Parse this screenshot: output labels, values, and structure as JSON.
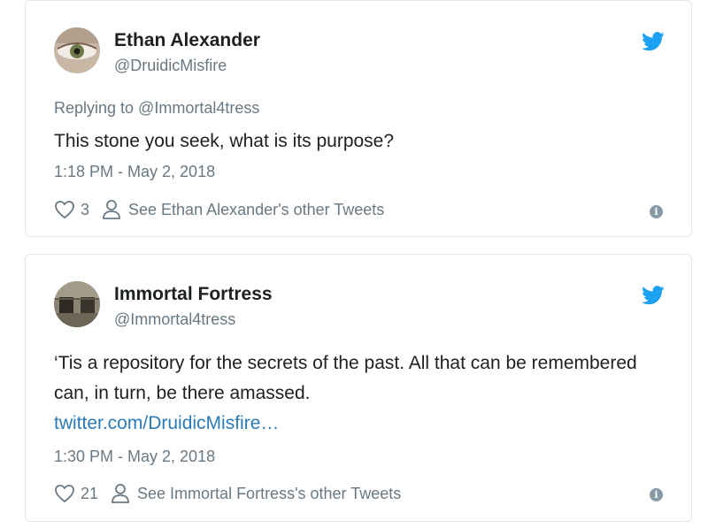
{
  "tweets": [
    {
      "author_name": "Ethan Alexander",
      "handle": "@DruidicMisfire",
      "reply_to": "Replying to @Immortal4tress",
      "text": "This stone you seek, what is its purpose?",
      "link": "",
      "timestamp": "1:18 PM - May 2, 2018",
      "likes": "3",
      "other_tweets_label": "See Ethan Alexander's other Tweets",
      "info_icon": "i"
    },
    {
      "author_name": "Immortal Fortress",
      "handle": "@Immortal4tress",
      "reply_to": "",
      "text": "‘Tis a repository for the secrets of the past. All that can be remembered can, in turn, be there amassed.",
      "link": "twitter.com/DruidicMisfire…",
      "timestamp": "1:30 PM - May 2, 2018",
      "likes": "21",
      "other_tweets_label": "See Immortal Fortress's other Tweets",
      "info_icon": "i"
    }
  ],
  "colors": {
    "twitter_blue": "#1da1f2",
    "link_blue": "#2b7bb9",
    "secondary_text": "#697882",
    "primary_text": "#1c2022",
    "card_border": "#e1e8ed"
  },
  "icons": [
    "twitter-bird-icon",
    "heart-icon",
    "person-icon",
    "info-icon"
  ]
}
